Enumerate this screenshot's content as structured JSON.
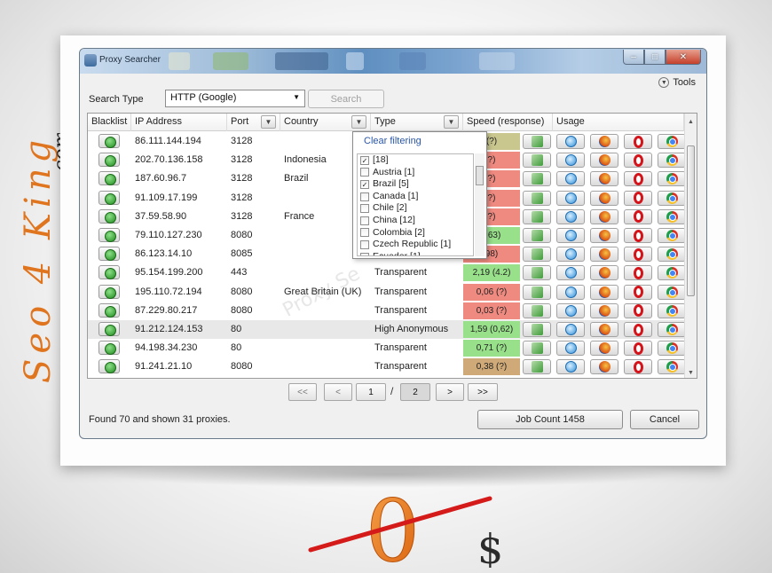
{
  "brand": {
    "text": "Seo 4 King",
    "suffix": ".com",
    "color": "#e0751f"
  },
  "window": {
    "title": "Proxy Searcher",
    "controls": [
      "–",
      "□",
      "✕"
    ]
  },
  "toolbar": {
    "tools_label": "Tools",
    "search_type_label": "Search Type",
    "search_type_value": "HTTP (Google)",
    "search_button": "Search"
  },
  "columns": {
    "blacklist": "Blacklist",
    "ip": "IP Address",
    "port": "Port",
    "country": "Country",
    "type": "Type",
    "speed": "Speed (response)",
    "usage": "Usage"
  },
  "rows": [
    {
      "ip": "86.111.144.194",
      "port": "3128",
      "country": "",
      "type": "",
      "speed": "(?)",
      "speed_color": "#c9c78e"
    },
    {
      "ip": "202.70.136.158",
      "port": "3128",
      "country": "Indonesia",
      "type": "",
      "speed": "?)",
      "speed_color": "#ef8a80"
    },
    {
      "ip": "187.60.96.7",
      "port": "3128",
      "country": "Brazil",
      "type": "",
      "speed": "?)",
      "speed_color": "#ef8a80"
    },
    {
      "ip": "91.109.17.199",
      "port": "3128",
      "country": "",
      "type": "",
      "speed": "?)",
      "speed_color": "#ef8a80"
    },
    {
      "ip": "37.59.58.90",
      "port": "3128",
      "country": "France",
      "type": "",
      "speed": "?)",
      "speed_color": "#ef8a80"
    },
    {
      "ip": "79.110.127.230",
      "port": "8080",
      "country": "",
      "type": "",
      "speed": "(.63)",
      "speed_color": "#98e08a"
    },
    {
      "ip": "86.123.14.10",
      "port": "8085",
      "country": "",
      "type": "",
      "speed": "98)",
      "speed_color": "#ef8a80"
    },
    {
      "ip": "95.154.199.200",
      "port": "443",
      "country": "",
      "type": "Transparent",
      "speed": "2,19 (4.2)",
      "speed_color": "#98e08a"
    },
    {
      "ip": "195.110.72.194",
      "port": "8080",
      "country": "Great Britain (UK)",
      "type": "Transparent",
      "speed": "0,06 (?)",
      "speed_color": "#ef8a80"
    },
    {
      "ip": "87.229.80.217",
      "port": "8080",
      "country": "",
      "type": "Transparent",
      "speed": "0,03 (?)",
      "speed_color": "#ef8a80"
    },
    {
      "ip": "91.212.124.153",
      "port": "80",
      "country": "",
      "type": "High Anonymous",
      "speed": "1,59 (0,62)",
      "speed_color": "#98e08a"
    },
    {
      "ip": "94.198.34.230",
      "port": "80",
      "country": "",
      "type": "Transparent",
      "speed": "0,71 (?)",
      "speed_color": "#98e08a"
    },
    {
      "ip": "91.241.21.10",
      "port": "8080",
      "country": "",
      "type": "Transparent",
      "speed": "0,38 (?)",
      "speed_color": "#cfaa78"
    }
  ],
  "filter_popup": {
    "clear": "Clear filtering",
    "options": [
      {
        "label": "[18]",
        "checked": true
      },
      {
        "label": "Austria [1]",
        "checked": false
      },
      {
        "label": "Brazil [5]",
        "checked": true
      },
      {
        "label": "Canada [1]",
        "checked": false
      },
      {
        "label": "Chile [2]",
        "checked": false
      },
      {
        "label": "China [12]",
        "checked": false
      },
      {
        "label": "Colombia [2]",
        "checked": false
      },
      {
        "label": "Czech Republic [1]",
        "checked": false
      },
      {
        "label": "Ecuador [1]",
        "checked": false
      }
    ]
  },
  "watermark": "Proxy Se",
  "pager": {
    "first": "<<",
    "prev": "<",
    "current": "1",
    "sep": "/",
    "total": "2",
    "next": ">",
    "last": ">>"
  },
  "status": {
    "text": "Found 70 and shown 31 proxies."
  },
  "buttons": {
    "job_count": "Job Count 1458",
    "cancel": "Cancel"
  },
  "price": {
    "value": "0",
    "currency": "$"
  }
}
